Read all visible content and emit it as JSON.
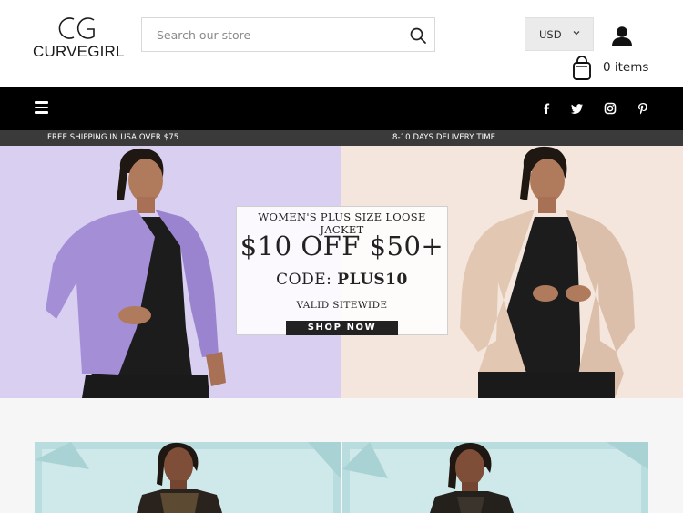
{
  "brand": {
    "name": "CURVEGIRL",
    "logo_mark": "CG"
  },
  "search": {
    "placeholder": "Search our store",
    "value": ""
  },
  "currency": {
    "selected": "USD"
  },
  "cart": {
    "label": "0 items"
  },
  "nav": {
    "menu_icon": "hamburger-icon",
    "social": [
      "facebook-icon",
      "twitter-icon",
      "instagram-icon",
      "pinterest-icon"
    ]
  },
  "announcements": {
    "left": "FREE SHIPPING IN USA OVER $75",
    "right": "8-10 DAYS DELIVERY TIME"
  },
  "hero": {
    "headline": "WOMEN'S PLUS SIZE LOOSE JACKET",
    "offer": "$10 OFF $50+",
    "code_prefix": "CODE: ",
    "code": "PLUS10",
    "validity": "VALID SITEWIDE",
    "cta": "SHOP NOW",
    "colors": {
      "left_bg": "#d9cff1",
      "right_bg": "#f4e6dc",
      "left_jacket": "#a48fd6",
      "right_jacket": "#e2c7b3"
    }
  },
  "colors": {
    "navbar": "#000000",
    "infobar": "#3a3a3a",
    "card_bg": "#b9dcde"
  }
}
